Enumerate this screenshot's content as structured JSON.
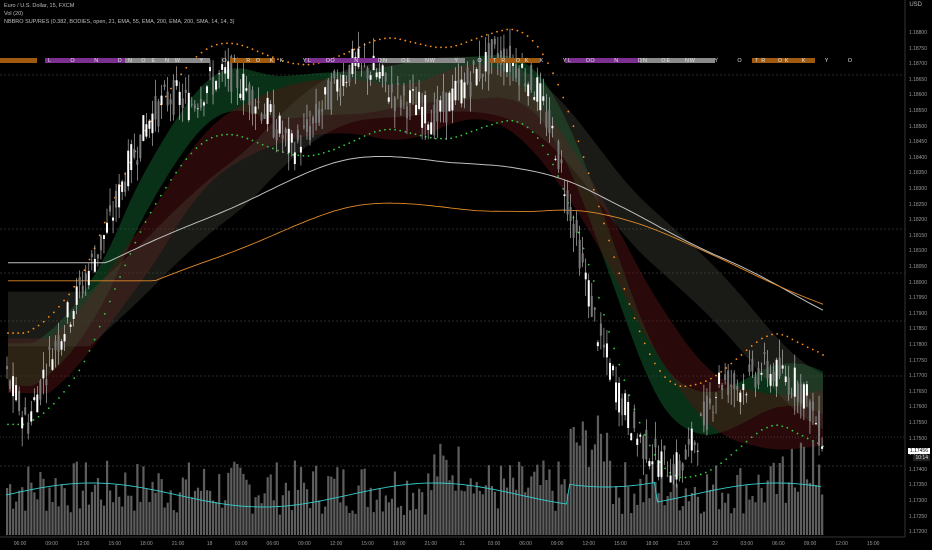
{
  "header": {
    "symbol": "Euro / U.S. Dollar, 15, FXCM",
    "volume": "Vol (20)",
    "indicator": "NBBRO SUP/RES (0.382, BODIES, open, 21, EMA, 55, EMA, 200, EMA, 200, SMA, 14, 14, 3)"
  },
  "currency": "USD",
  "price_axis": [
    "1.18800",
    "1.18750",
    "1.18700",
    "1.18650",
    "1.18600",
    "1.18550",
    "1.18500",
    "1.18450",
    "1.18400",
    "1.18350",
    "1.18300",
    "1.18250",
    "1.18200",
    "1.18150",
    "1.18100",
    "1.18050",
    "1.18000",
    "1.17950",
    "1.17900",
    "1.17850",
    "1.17800",
    "1.17750",
    "1.17700",
    "1.17650",
    "1.17600",
    "1.17550",
    "1.17500",
    "1.17450",
    "1.17400",
    "1.17350",
    "1.17300",
    "1.17250",
    "1.17200"
  ],
  "last_price": {
    "value": "1.17456",
    "countdown": "10:14",
    "color": "#ffffff"
  },
  "time_axis": [
    "06:00",
    "09:00",
    "12:00",
    "15:00",
    "18:00",
    "21:00",
    "18",
    "03:00",
    "06:00",
    "09:00",
    "12:00",
    "15:00",
    "18:00",
    "21:00",
    "21",
    "03:00",
    "06:00",
    "09:00",
    "12:00",
    "15:00",
    "18:00",
    "21:00",
    "22",
    "03:00",
    "06:00",
    "09:00",
    "12:00",
    "15:00"
  ],
  "sessions": [
    {
      "label": "L O N D O N",
      "kind": "london"
    },
    {
      "label": "N E W  Y O R K",
      "kind": "ny"
    },
    {
      "label": "T O K Y O",
      "kind": "tokyo"
    },
    {
      "label": "L O N D O N",
      "kind": "london"
    },
    {
      "label": "N E W  Y O R K",
      "kind": "ny"
    },
    {
      "label": "T O K Y O",
      "kind": "tokyo"
    },
    {
      "label": "L O N D O N",
      "kind": "london"
    },
    {
      "label": "N E W  Y O R K",
      "kind": "ny"
    },
    {
      "label": "T O K Y O",
      "kind": "tokyo"
    }
  ],
  "colors": {
    "london": "#7b2f8f",
    "ny": "#8a8a8a",
    "tokyo": "#a05a10",
    "ema200": "#c0c0c0",
    "sma200": "#e08a28",
    "support": "#2ecc40",
    "resistance": "#ff8c1a",
    "vol_ma": "#33cccc"
  },
  "chart_data": {
    "type": "candlestick",
    "price_range": [
      1.172,
      1.188
    ],
    "close_path": [
      1.1765,
      1.175,
      1.177,
      1.1785,
      1.18,
      1.1815,
      1.1835,
      1.185,
      1.1858,
      1.1855,
      1.1862,
      1.1865,
      1.1858,
      1.185,
      1.184,
      1.1848,
      1.186,
      1.1868,
      1.1866,
      1.1858,
      1.1855,
      1.185,
      1.1858,
      1.1865,
      1.1872,
      1.1868,
      1.186,
      1.184,
      1.181,
      1.178,
      1.176,
      1.1745,
      1.1738,
      1.1735,
      1.1748,
      1.1765,
      1.1762,
      1.1768,
      1.1766,
      1.1762,
      1.1746
    ]
  }
}
